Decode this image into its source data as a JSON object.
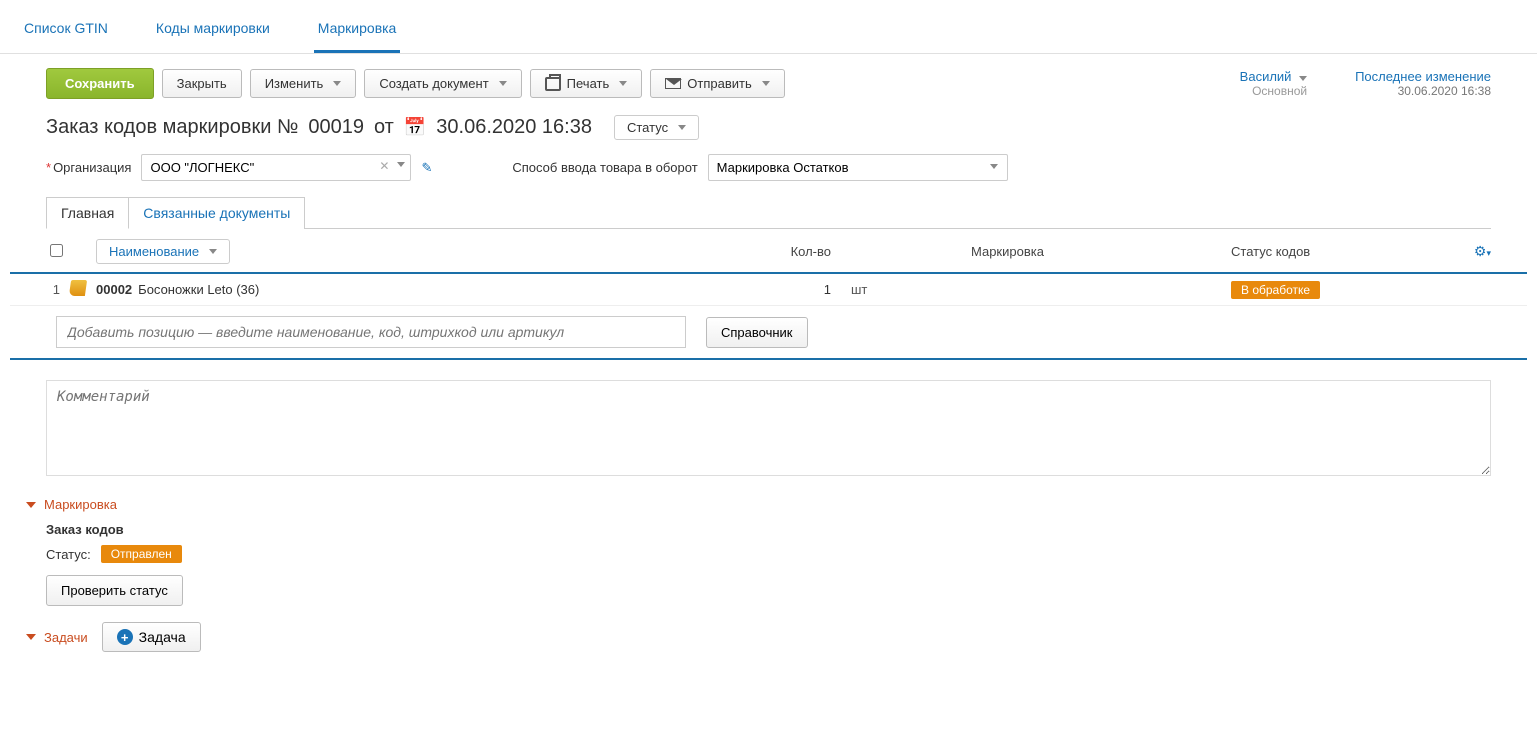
{
  "topTabs": {
    "gtin": "Список GTIN",
    "codes": "Коды маркировки",
    "marking": "Маркировка"
  },
  "toolbar": {
    "save": "Сохранить",
    "close": "Закрыть",
    "edit": "Изменить",
    "createDoc": "Создать документ",
    "print": "Печать",
    "send": "Отправить"
  },
  "user": {
    "name": "Василий",
    "role": "Основной"
  },
  "lastChange": {
    "label": "Последнее изменение",
    "value": "30.06.2020 16:38"
  },
  "title": {
    "prefix": "Заказ кодов маркировки №",
    "number": "00019",
    "from": "от",
    "datetime": "30.06.2020 16:38",
    "statusLabel": "Статус"
  },
  "form": {
    "orgLabel": "Организация",
    "orgValue": "ООО \"ЛОГНЕКС\"",
    "methodLabel": "Способ ввода товара в оборот",
    "methodValue": "Маркировка Остатков"
  },
  "subTabs": {
    "main": "Главная",
    "linked": "Связанные документы"
  },
  "table": {
    "nameHeader": "Наименование",
    "qtyHeader": "Кол-во",
    "markHeader": "Маркировка",
    "statusHeader": "Статус кодов",
    "rows": [
      {
        "num": "1",
        "code": "00002",
        "name": "Босоножки Leto (36)",
        "qty": "1",
        "unit": "шт",
        "marking": "",
        "status": "В обработке"
      }
    ],
    "addPlaceholder": "Добавить позицию — введите наименование, код, штрихкод или артикул",
    "refBtn": "Справочник"
  },
  "commentPlaceholder": "Комментарий",
  "marking": {
    "head": "Маркировка",
    "orderTitle": "Заказ кодов",
    "statusLabel": "Статус:",
    "statusValue": "Отправлен",
    "checkBtn": "Проверить статус"
  },
  "tasks": {
    "head": "Задачи",
    "addBtn": "Задача"
  }
}
